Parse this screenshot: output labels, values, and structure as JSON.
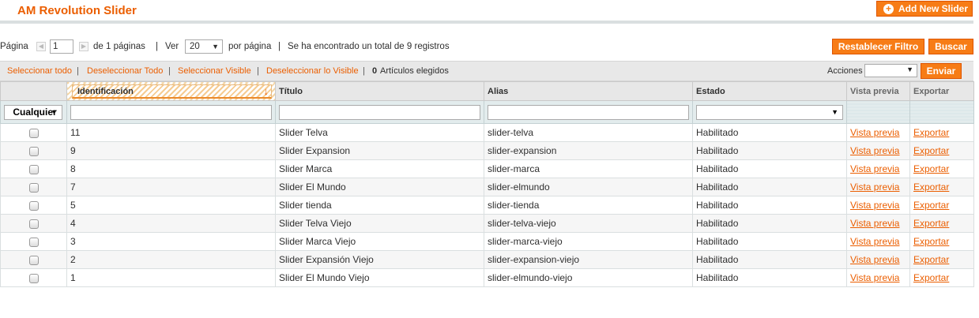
{
  "header": {
    "title": "AM Revolution Slider",
    "add_button": "Add New Slider"
  },
  "pager": {
    "page_label": "Página",
    "page_value": "1",
    "of_pages": "de 1 páginas",
    "sep": "|",
    "view_label": "Ver",
    "per_page_value": "20",
    "per_page_suffix": "por página",
    "total_text": "Se ha encontrado un total de 9 registros"
  },
  "buttons": {
    "reset_filter": "Restablecer Filtro",
    "search": "Buscar",
    "submit": "Enviar"
  },
  "massaction": {
    "select_all": "Seleccionar todo",
    "unselect_all": "Deseleccionar Todo",
    "select_visible": "Seleccionar Visible",
    "unselect_visible": "Deseleccionar lo Visible",
    "selected_count": "0",
    "selected_label": "Artículos elegidos",
    "actions_label": "Acciones",
    "sep": "|"
  },
  "columns": {
    "id": "Identificación",
    "title": "Título",
    "alias": "Alias",
    "status": "Estado",
    "preview": "Vista previa",
    "export": "Exportar"
  },
  "filters": {
    "massaction_any": "Cualquier"
  },
  "rows": [
    {
      "id": "11",
      "title": "Slider Telva",
      "alias": "slider-telva",
      "status": "Habilitado",
      "preview": "Vista previa",
      "export": "Exportar"
    },
    {
      "id": "9",
      "title": "Slider Expansion",
      "alias": "slider-expansion",
      "status": "Habilitado",
      "preview": "Vista previa",
      "export": "Exportar"
    },
    {
      "id": "8",
      "title": "Slider Marca",
      "alias": "slider-marca",
      "status": "Habilitado",
      "preview": "Vista previa",
      "export": "Exportar"
    },
    {
      "id": "7",
      "title": "Slider El Mundo",
      "alias": "slider-elmundo",
      "status": "Habilitado",
      "preview": "Vista previa",
      "export": "Exportar"
    },
    {
      "id": "5",
      "title": "Slider tienda",
      "alias": "slider-tienda",
      "status": "Habilitado",
      "preview": "Vista previa",
      "export": "Exportar"
    },
    {
      "id": "4",
      "title": "Slider Telva Viejo",
      "alias": "slider-telva-viejo",
      "status": "Habilitado",
      "preview": "Vista previa",
      "export": "Exportar"
    },
    {
      "id": "3",
      "title": "Slider Marca Viejo",
      "alias": "slider-marca-viejo",
      "status": "Habilitado",
      "preview": "Vista previa",
      "export": "Exportar"
    },
    {
      "id": "2",
      "title": "Slider Expansión Viejo",
      "alias": "slider-expansion-viejo",
      "status": "Habilitado",
      "preview": "Vista previa",
      "export": "Exportar"
    },
    {
      "id": "1",
      "title": "Slider El Mundo Viejo",
      "alias": "slider-elmundo-viejo",
      "status": "Habilitado",
      "preview": "Vista previa",
      "export": "Exportar"
    }
  ],
  "colors": {
    "accent": "#eb5e00",
    "button": "#f77c16"
  }
}
